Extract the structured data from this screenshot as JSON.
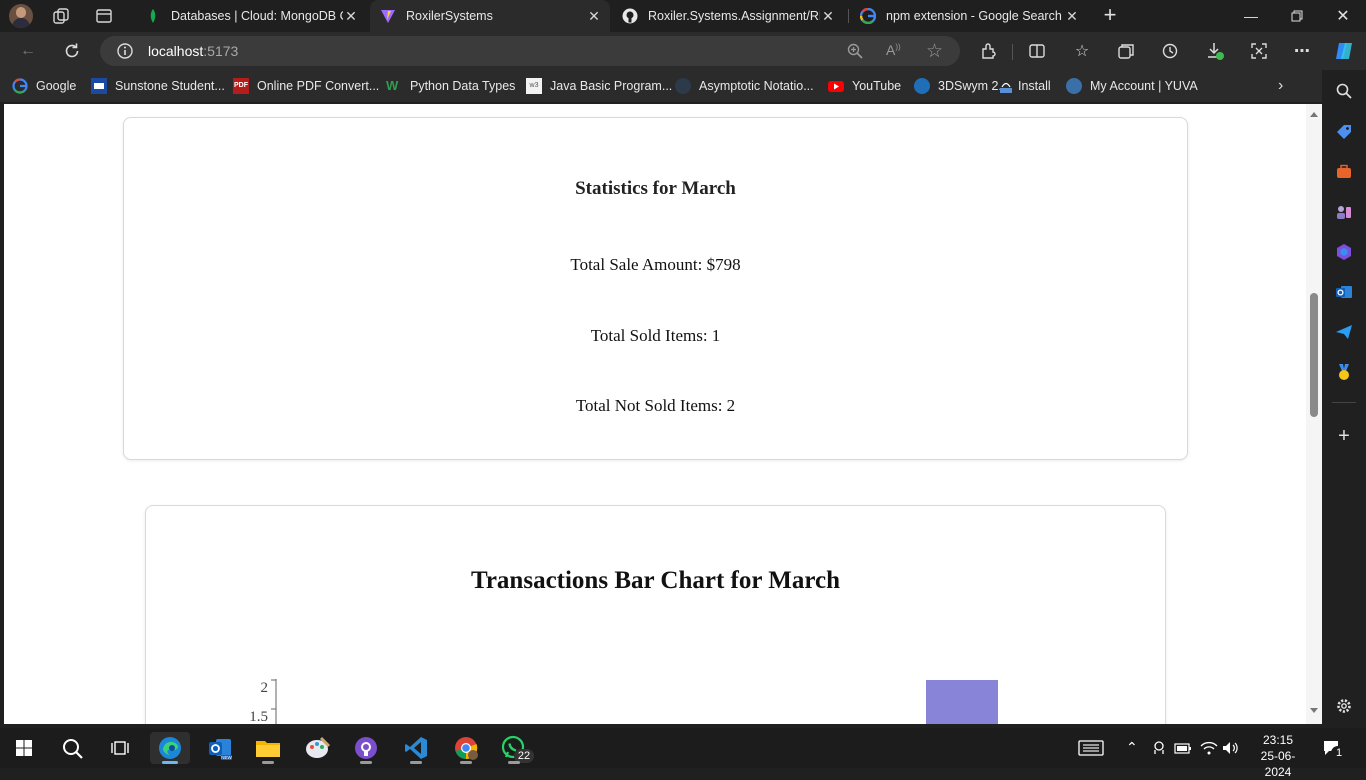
{
  "browser": {
    "tabs": [
      {
        "title": "Databases | Cloud: MongoDB Clo"
      },
      {
        "title": "RoxilerSystems"
      },
      {
        "title": "Roxiler.Systems.Assignment/REA"
      },
      {
        "title": "npm extension - Google Search"
      }
    ],
    "address": {
      "host": "localhost",
      "port": ":5173"
    },
    "bookmarks": [
      {
        "label": "Google"
      },
      {
        "label": "Sunstone Student..."
      },
      {
        "label": "Online PDF Convert..."
      },
      {
        "label": "Python Data Types"
      },
      {
        "label": "Java Basic Program..."
      },
      {
        "label": "Asymptotic Notatio..."
      },
      {
        "label": "YouTube"
      },
      {
        "label": "3DSwym 2."
      },
      {
        "label": "Install"
      },
      {
        "label": "My Account | YUVA"
      }
    ]
  },
  "statistics": {
    "title": "Statistics for March",
    "total_sale": "Total Sale Amount: $798",
    "total_sold": "Total Sold Items: 1",
    "total_not_sold": "Total Not Sold Items: 2"
  },
  "chart": {
    "title": "Transactions Bar Chart for March",
    "bar_color": "#8884d8"
  },
  "chart_data": {
    "type": "bar",
    "title": "Transactions Bar Chart for March",
    "yticks": [
      "2",
      "1.5"
    ],
    "ylim": [
      0,
      2
    ],
    "visible_bars": [
      {
        "value": 2
      }
    ]
  },
  "taskbar": {
    "whatsapp_badge": "22",
    "time": "23:15",
    "date": "25-06-2024",
    "notification_count": "1"
  },
  "colors": {
    "accent": "#0078d4"
  }
}
